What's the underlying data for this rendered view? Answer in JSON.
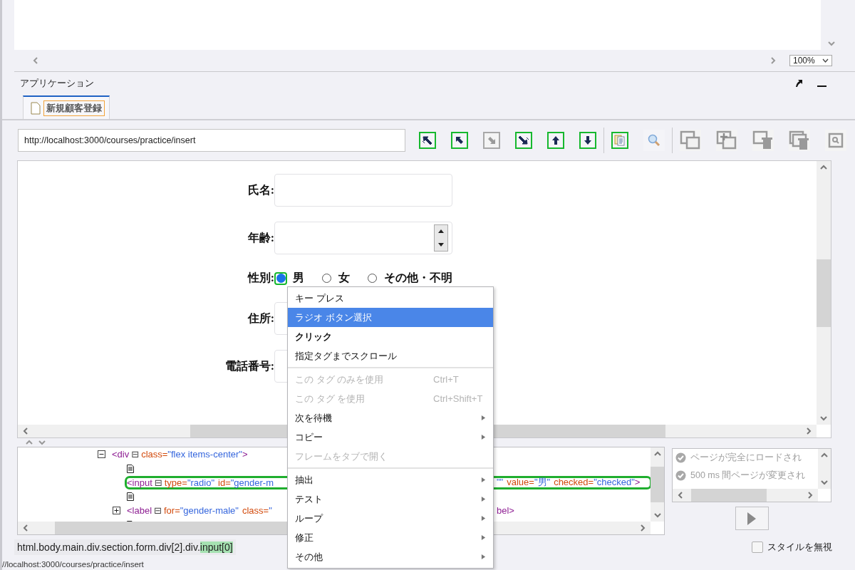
{
  "preview": {
    "zoom": "100%"
  },
  "panel": {
    "title": "アプリケーション"
  },
  "tabs": [
    {
      "label": "新規顧客登録",
      "selected": true
    }
  ],
  "toolbar": {
    "url": "http://localhost:3000/courses/practice/insert",
    "groups": [
      {
        "buttons": [
          {
            "kind": "select-up-left",
            "highlighted": true,
            "disabled": false
          },
          {
            "kind": "up-left",
            "highlighted": true,
            "disabled": false
          },
          {
            "kind": "down-right",
            "highlighted": false,
            "disabled": true
          },
          {
            "kind": "select-down-right",
            "highlighted": true,
            "disabled": false
          },
          {
            "kind": "up",
            "highlighted": true,
            "disabled": false
          },
          {
            "kind": "down",
            "highlighted": true,
            "disabled": false
          }
        ]
      },
      {
        "buttons": [
          {
            "kind": "document",
            "highlighted": true,
            "disabled": false
          },
          {
            "kind": "search",
            "highlighted": false,
            "disabled": false
          }
        ]
      },
      {
        "buttons": [
          {
            "kind": "window-capture",
            "highlighted": false,
            "disabled": true
          },
          {
            "kind": "window-add",
            "highlighted": false,
            "disabled": true
          },
          {
            "kind": "window-delete",
            "highlighted": false,
            "disabled": true
          },
          {
            "kind": "windows-delete",
            "highlighted": false,
            "disabled": true
          },
          {
            "kind": "window-inspect",
            "highlighted": false,
            "disabled": true
          }
        ]
      }
    ]
  },
  "form": {
    "rows": [
      {
        "label": "氏名:",
        "kind": "text"
      },
      {
        "label": "年齢:",
        "kind": "number"
      },
      {
        "label": "性別:",
        "kind": "radio",
        "options": [
          {
            "label": "男",
            "selected": true,
            "highlighted": true
          },
          {
            "label": "女",
            "selected": false,
            "highlighted": false
          },
          {
            "label": "その他・不明",
            "selected": false,
            "highlighted": false
          }
        ]
      },
      {
        "label": "住所:",
        "kind": "text"
      },
      {
        "label": "電話番号:",
        "kind": "text"
      }
    ]
  },
  "dom_tree": [
    {
      "kind": "element",
      "expanded": true,
      "highlighted": false,
      "segments": [
        [
          {
            "tag": "<div"
          },
          {
            "toggle": "⊟"
          },
          {
            "attr": "class="
          },
          {
            "value": "\"flex items-center\""
          },
          {
            "tag": ">"
          }
        ]
      ],
      "children": [
        {
          "kind": "text",
          "highlighted": false
        },
        {
          "kind": "element",
          "highlighted": true,
          "segments": [
            [
              {
                "tag": "<input"
              },
              {
                "toggle": "⊟"
              },
              {
                "attr": "type="
              },
              {
                "value": "\"radio\""
              },
              {
                "attr": "id="
              },
              {
                "value": "\"gender-m"
              }
            ],
            [
              {
                "value": "\"\""
              },
              {
                "attr": "value="
              },
              {
                "value": "\"男\""
              },
              {
                "attr": "checked="
              },
              {
                "value": "\"checked\""
              },
              {
                "tag": ">"
              }
            ]
          ]
        },
        {
          "kind": "text",
          "highlighted": false
        },
        {
          "kind": "element",
          "expanded": false,
          "highlighted": false,
          "segments": [
            [
              {
                "tag": "<label"
              },
              {
                "toggle": "⊟"
              },
              {
                "attr": "for="
              },
              {
                "value": "\"gender-male\""
              },
              {
                "attr": "class="
              },
              {
                "value": "\""
              }
            ],
            [
              {
                "tag": "bel>"
              }
            ]
          ]
        },
        {
          "kind": "text",
          "highlighted": false
        }
      ]
    }
  ],
  "wait_conditions": [
    {
      "text": "ページが完全にロードされ",
      "disabled": true
    },
    {
      "text": "500 ms 間ページが変更され",
      "disabled": true
    }
  ],
  "path": {
    "prefix": "html.body.main.div.section.form.div[2].div.",
    "current": "input[0]"
  },
  "ignore_style": {
    "label": "スタイルを無視",
    "checked": false
  },
  "status_bar": "//localhost:3000/courses/practice/insert",
  "context_menu": [
    {
      "kind": "item",
      "label": "キー プレス",
      "selected": false,
      "disabled": false,
      "default": false,
      "submenu": false
    },
    {
      "kind": "item",
      "label": "ラジオ ボタン選択",
      "selected": true,
      "disabled": false,
      "default": false,
      "submenu": false
    },
    {
      "kind": "item",
      "label": "クリック",
      "selected": false,
      "disabled": false,
      "default": true,
      "submenu": false
    },
    {
      "kind": "item",
      "label": "指定タグまでスクロール",
      "selected": false,
      "disabled": false,
      "default": false,
      "submenu": false
    },
    {
      "kind": "separator"
    },
    {
      "kind": "item",
      "label": "この タグ のみを使用",
      "shortcut": "Ctrl+T",
      "selected": false,
      "disabled": true,
      "default": false,
      "submenu": false
    },
    {
      "kind": "item",
      "label": "この タグ を使用",
      "shortcut": "Ctrl+Shift+T",
      "selected": false,
      "disabled": true,
      "default": false,
      "submenu": false
    },
    {
      "kind": "item",
      "label": "次を待機",
      "selected": false,
      "disabled": false,
      "default": false,
      "submenu": true
    },
    {
      "kind": "item",
      "label": "コピー",
      "selected": false,
      "disabled": false,
      "default": false,
      "submenu": true
    },
    {
      "kind": "item",
      "label": "フレームをタブで開く",
      "selected": false,
      "disabled": true,
      "default": false,
      "submenu": false
    },
    {
      "kind": "separator"
    },
    {
      "kind": "item",
      "label": "抽出",
      "selected": false,
      "disabled": false,
      "default": false,
      "submenu": true
    },
    {
      "kind": "item",
      "label": "テスト",
      "selected": false,
      "disabled": false,
      "default": false,
      "submenu": true
    },
    {
      "kind": "item",
      "label": "ループ",
      "selected": false,
      "disabled": false,
      "default": false,
      "submenu": true
    },
    {
      "kind": "item",
      "label": "修正",
      "selected": false,
      "disabled": false,
      "default": false,
      "submenu": true
    },
    {
      "kind": "item",
      "label": "その他",
      "selected": false,
      "disabled": false,
      "default": false,
      "submenu": true
    }
  ]
}
